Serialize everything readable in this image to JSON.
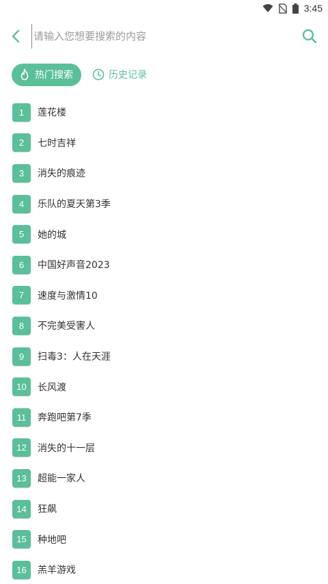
{
  "status_bar": {
    "time": "3:45"
  },
  "search": {
    "placeholder": "请输入您想要搜索的内容"
  },
  "tabs": [
    {
      "label": "热门搜索",
      "icon": "flame-icon",
      "active": true
    },
    {
      "label": "历史记录",
      "icon": "clock-icon",
      "active": false
    }
  ],
  "hot_list": [
    {
      "rank": "1",
      "title": "莲花楼"
    },
    {
      "rank": "2",
      "title": "七时吉祥"
    },
    {
      "rank": "3",
      "title": "消失的痕迹"
    },
    {
      "rank": "4",
      "title": "乐队的夏天第3季"
    },
    {
      "rank": "5",
      "title": "她的城"
    },
    {
      "rank": "6",
      "title": "中国好声音2023"
    },
    {
      "rank": "7",
      "title": "速度与激情10"
    },
    {
      "rank": "8",
      "title": "不完美受害人"
    },
    {
      "rank": "9",
      "title": "扫毒3：人在天涯"
    },
    {
      "rank": "10",
      "title": "长风渡"
    },
    {
      "rank": "11",
      "title": "奔跑吧第7季"
    },
    {
      "rank": "12",
      "title": "消失的十一层"
    },
    {
      "rank": "13",
      "title": "超能一家人"
    },
    {
      "rank": "14",
      "title": "狂飙"
    },
    {
      "rank": "15",
      "title": "种地吧"
    },
    {
      "rank": "16",
      "title": "羔羊游戏"
    }
  ],
  "colors": {
    "accent": "#5bbf9a",
    "text": "#333333",
    "placeholder": "#9b9b9b"
  }
}
